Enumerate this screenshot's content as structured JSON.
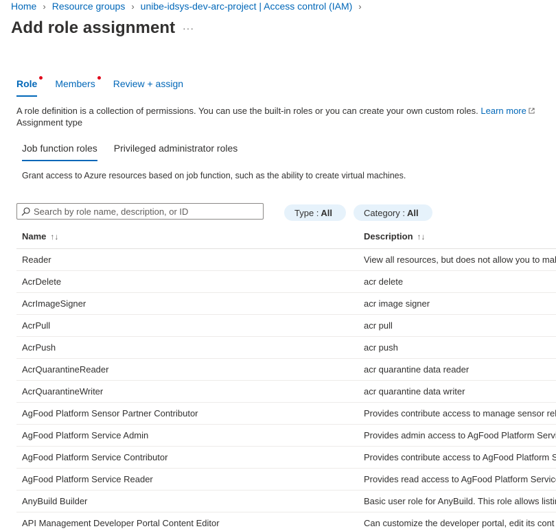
{
  "breadcrumb": [
    {
      "label": "Home"
    },
    {
      "label": "Resource groups"
    },
    {
      "label": "unibe-idsys-dev-arc-project | Access control (IAM)"
    }
  ],
  "page": {
    "title": "Add role assignment",
    "more_label": "···"
  },
  "tabs": [
    {
      "label": "Role",
      "required": true,
      "active": true
    },
    {
      "label": "Members",
      "required": true,
      "active": false
    },
    {
      "label": "Review + assign",
      "required": false,
      "active": false
    }
  ],
  "description": {
    "text": "A role definition is a collection of permissions. You can use the built-in roles or you can create your own custom roles.",
    "learn_more": "Learn more",
    "assignment_type": "Assignment type"
  },
  "subtabs": [
    {
      "label": "Job function roles",
      "active": true
    },
    {
      "label": "Privileged administrator roles",
      "active": false
    }
  ],
  "grant_text": "Grant access to Azure resources based on job function, such as the ability to create virtual machines.",
  "search": {
    "placeholder": "Search by role name, description, or ID",
    "icon": "search-icon"
  },
  "filters": {
    "type": {
      "label": "Type :",
      "value": "All"
    },
    "category": {
      "label": "Category :",
      "value": "All"
    }
  },
  "table": {
    "columns": [
      {
        "label": "Name",
        "sort_icon": "↑↓"
      },
      {
        "label": "Description",
        "sort_icon": "↑↓"
      }
    ],
    "rows": [
      {
        "name": "Reader",
        "description": "View all resources, but does not allow you to mal"
      },
      {
        "name": "AcrDelete",
        "description": "acr delete"
      },
      {
        "name": "AcrImageSigner",
        "description": "acr image signer"
      },
      {
        "name": "AcrPull",
        "description": "acr pull"
      },
      {
        "name": "AcrPush",
        "description": "acr push"
      },
      {
        "name": "AcrQuarantineReader",
        "description": "acr quarantine data reader"
      },
      {
        "name": "AcrQuarantineWriter",
        "description": "acr quarantine data writer"
      },
      {
        "name": "AgFood Platform Sensor Partner Contributor",
        "description": "Provides contribute access to manage sensor rela"
      },
      {
        "name": "AgFood Platform Service Admin",
        "description": "Provides admin access to AgFood Platform Servic"
      },
      {
        "name": "AgFood Platform Service Contributor",
        "description": "Provides contribute access to AgFood Platform S"
      },
      {
        "name": "AgFood Platform Service Reader",
        "description": "Provides read access to AgFood Platform Service"
      },
      {
        "name": "AnyBuild Builder",
        "description": "Basic user role for AnyBuild. This role allows listin"
      },
      {
        "name": "API Management Developer Portal Content Editor",
        "description": "Can customize the developer portal, edit its cont"
      }
    ]
  },
  "colors": {
    "link": "#0067b8",
    "required_dot": "#e00b1c",
    "pill_bg": "#e6f2fb"
  }
}
